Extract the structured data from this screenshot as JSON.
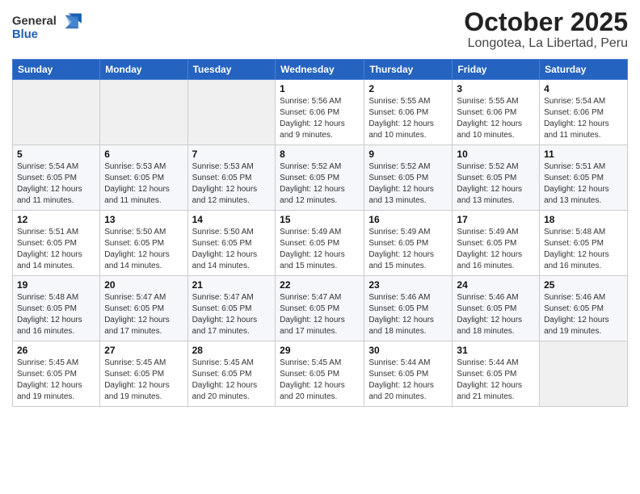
{
  "header": {
    "logo_general": "General",
    "logo_blue": "Blue",
    "title": "October 2025",
    "subtitle": "Longotea, La Libertad, Peru"
  },
  "weekdays": [
    "Sunday",
    "Monday",
    "Tuesday",
    "Wednesday",
    "Thursday",
    "Friday",
    "Saturday"
  ],
  "weeks": [
    [
      {
        "day": "",
        "info": ""
      },
      {
        "day": "",
        "info": ""
      },
      {
        "day": "",
        "info": ""
      },
      {
        "day": "1",
        "info": "Sunrise: 5:56 AM\nSunset: 6:06 PM\nDaylight: 12 hours\nand 9 minutes."
      },
      {
        "day": "2",
        "info": "Sunrise: 5:55 AM\nSunset: 6:06 PM\nDaylight: 12 hours\nand 10 minutes."
      },
      {
        "day": "3",
        "info": "Sunrise: 5:55 AM\nSunset: 6:06 PM\nDaylight: 12 hours\nand 10 minutes."
      },
      {
        "day": "4",
        "info": "Sunrise: 5:54 AM\nSunset: 6:06 PM\nDaylight: 12 hours\nand 11 minutes."
      }
    ],
    [
      {
        "day": "5",
        "info": "Sunrise: 5:54 AM\nSunset: 6:05 PM\nDaylight: 12 hours\nand 11 minutes."
      },
      {
        "day": "6",
        "info": "Sunrise: 5:53 AM\nSunset: 6:05 PM\nDaylight: 12 hours\nand 11 minutes."
      },
      {
        "day": "7",
        "info": "Sunrise: 5:53 AM\nSunset: 6:05 PM\nDaylight: 12 hours\nand 12 minutes."
      },
      {
        "day": "8",
        "info": "Sunrise: 5:52 AM\nSunset: 6:05 PM\nDaylight: 12 hours\nand 12 minutes."
      },
      {
        "day": "9",
        "info": "Sunrise: 5:52 AM\nSunset: 6:05 PM\nDaylight: 12 hours\nand 13 minutes."
      },
      {
        "day": "10",
        "info": "Sunrise: 5:52 AM\nSunset: 6:05 PM\nDaylight: 12 hours\nand 13 minutes."
      },
      {
        "day": "11",
        "info": "Sunrise: 5:51 AM\nSunset: 6:05 PM\nDaylight: 12 hours\nand 13 minutes."
      }
    ],
    [
      {
        "day": "12",
        "info": "Sunrise: 5:51 AM\nSunset: 6:05 PM\nDaylight: 12 hours\nand 14 minutes."
      },
      {
        "day": "13",
        "info": "Sunrise: 5:50 AM\nSunset: 6:05 PM\nDaylight: 12 hours\nand 14 minutes."
      },
      {
        "day": "14",
        "info": "Sunrise: 5:50 AM\nSunset: 6:05 PM\nDaylight: 12 hours\nand 14 minutes."
      },
      {
        "day": "15",
        "info": "Sunrise: 5:49 AM\nSunset: 6:05 PM\nDaylight: 12 hours\nand 15 minutes."
      },
      {
        "day": "16",
        "info": "Sunrise: 5:49 AM\nSunset: 6:05 PM\nDaylight: 12 hours\nand 15 minutes."
      },
      {
        "day": "17",
        "info": "Sunrise: 5:49 AM\nSunset: 6:05 PM\nDaylight: 12 hours\nand 16 minutes."
      },
      {
        "day": "18",
        "info": "Sunrise: 5:48 AM\nSunset: 6:05 PM\nDaylight: 12 hours\nand 16 minutes."
      }
    ],
    [
      {
        "day": "19",
        "info": "Sunrise: 5:48 AM\nSunset: 6:05 PM\nDaylight: 12 hours\nand 16 minutes."
      },
      {
        "day": "20",
        "info": "Sunrise: 5:47 AM\nSunset: 6:05 PM\nDaylight: 12 hours\nand 17 minutes."
      },
      {
        "day": "21",
        "info": "Sunrise: 5:47 AM\nSunset: 6:05 PM\nDaylight: 12 hours\nand 17 minutes."
      },
      {
        "day": "22",
        "info": "Sunrise: 5:47 AM\nSunset: 6:05 PM\nDaylight: 12 hours\nand 17 minutes."
      },
      {
        "day": "23",
        "info": "Sunrise: 5:46 AM\nSunset: 6:05 PM\nDaylight: 12 hours\nand 18 minutes."
      },
      {
        "day": "24",
        "info": "Sunrise: 5:46 AM\nSunset: 6:05 PM\nDaylight: 12 hours\nand 18 minutes."
      },
      {
        "day": "25",
        "info": "Sunrise: 5:46 AM\nSunset: 6:05 PM\nDaylight: 12 hours\nand 19 minutes."
      }
    ],
    [
      {
        "day": "26",
        "info": "Sunrise: 5:45 AM\nSunset: 6:05 PM\nDaylight: 12 hours\nand 19 minutes."
      },
      {
        "day": "27",
        "info": "Sunrise: 5:45 AM\nSunset: 6:05 PM\nDaylight: 12 hours\nand 19 minutes."
      },
      {
        "day": "28",
        "info": "Sunrise: 5:45 AM\nSunset: 6:05 PM\nDaylight: 12 hours\nand 20 minutes."
      },
      {
        "day": "29",
        "info": "Sunrise: 5:45 AM\nSunset: 6:05 PM\nDaylight: 12 hours\nand 20 minutes."
      },
      {
        "day": "30",
        "info": "Sunrise: 5:44 AM\nSunset: 6:05 PM\nDaylight: 12 hours\nand 20 minutes."
      },
      {
        "day": "31",
        "info": "Sunrise: 5:44 AM\nSunset: 6:05 PM\nDaylight: 12 hours\nand 21 minutes."
      },
      {
        "day": "",
        "info": ""
      }
    ]
  ]
}
